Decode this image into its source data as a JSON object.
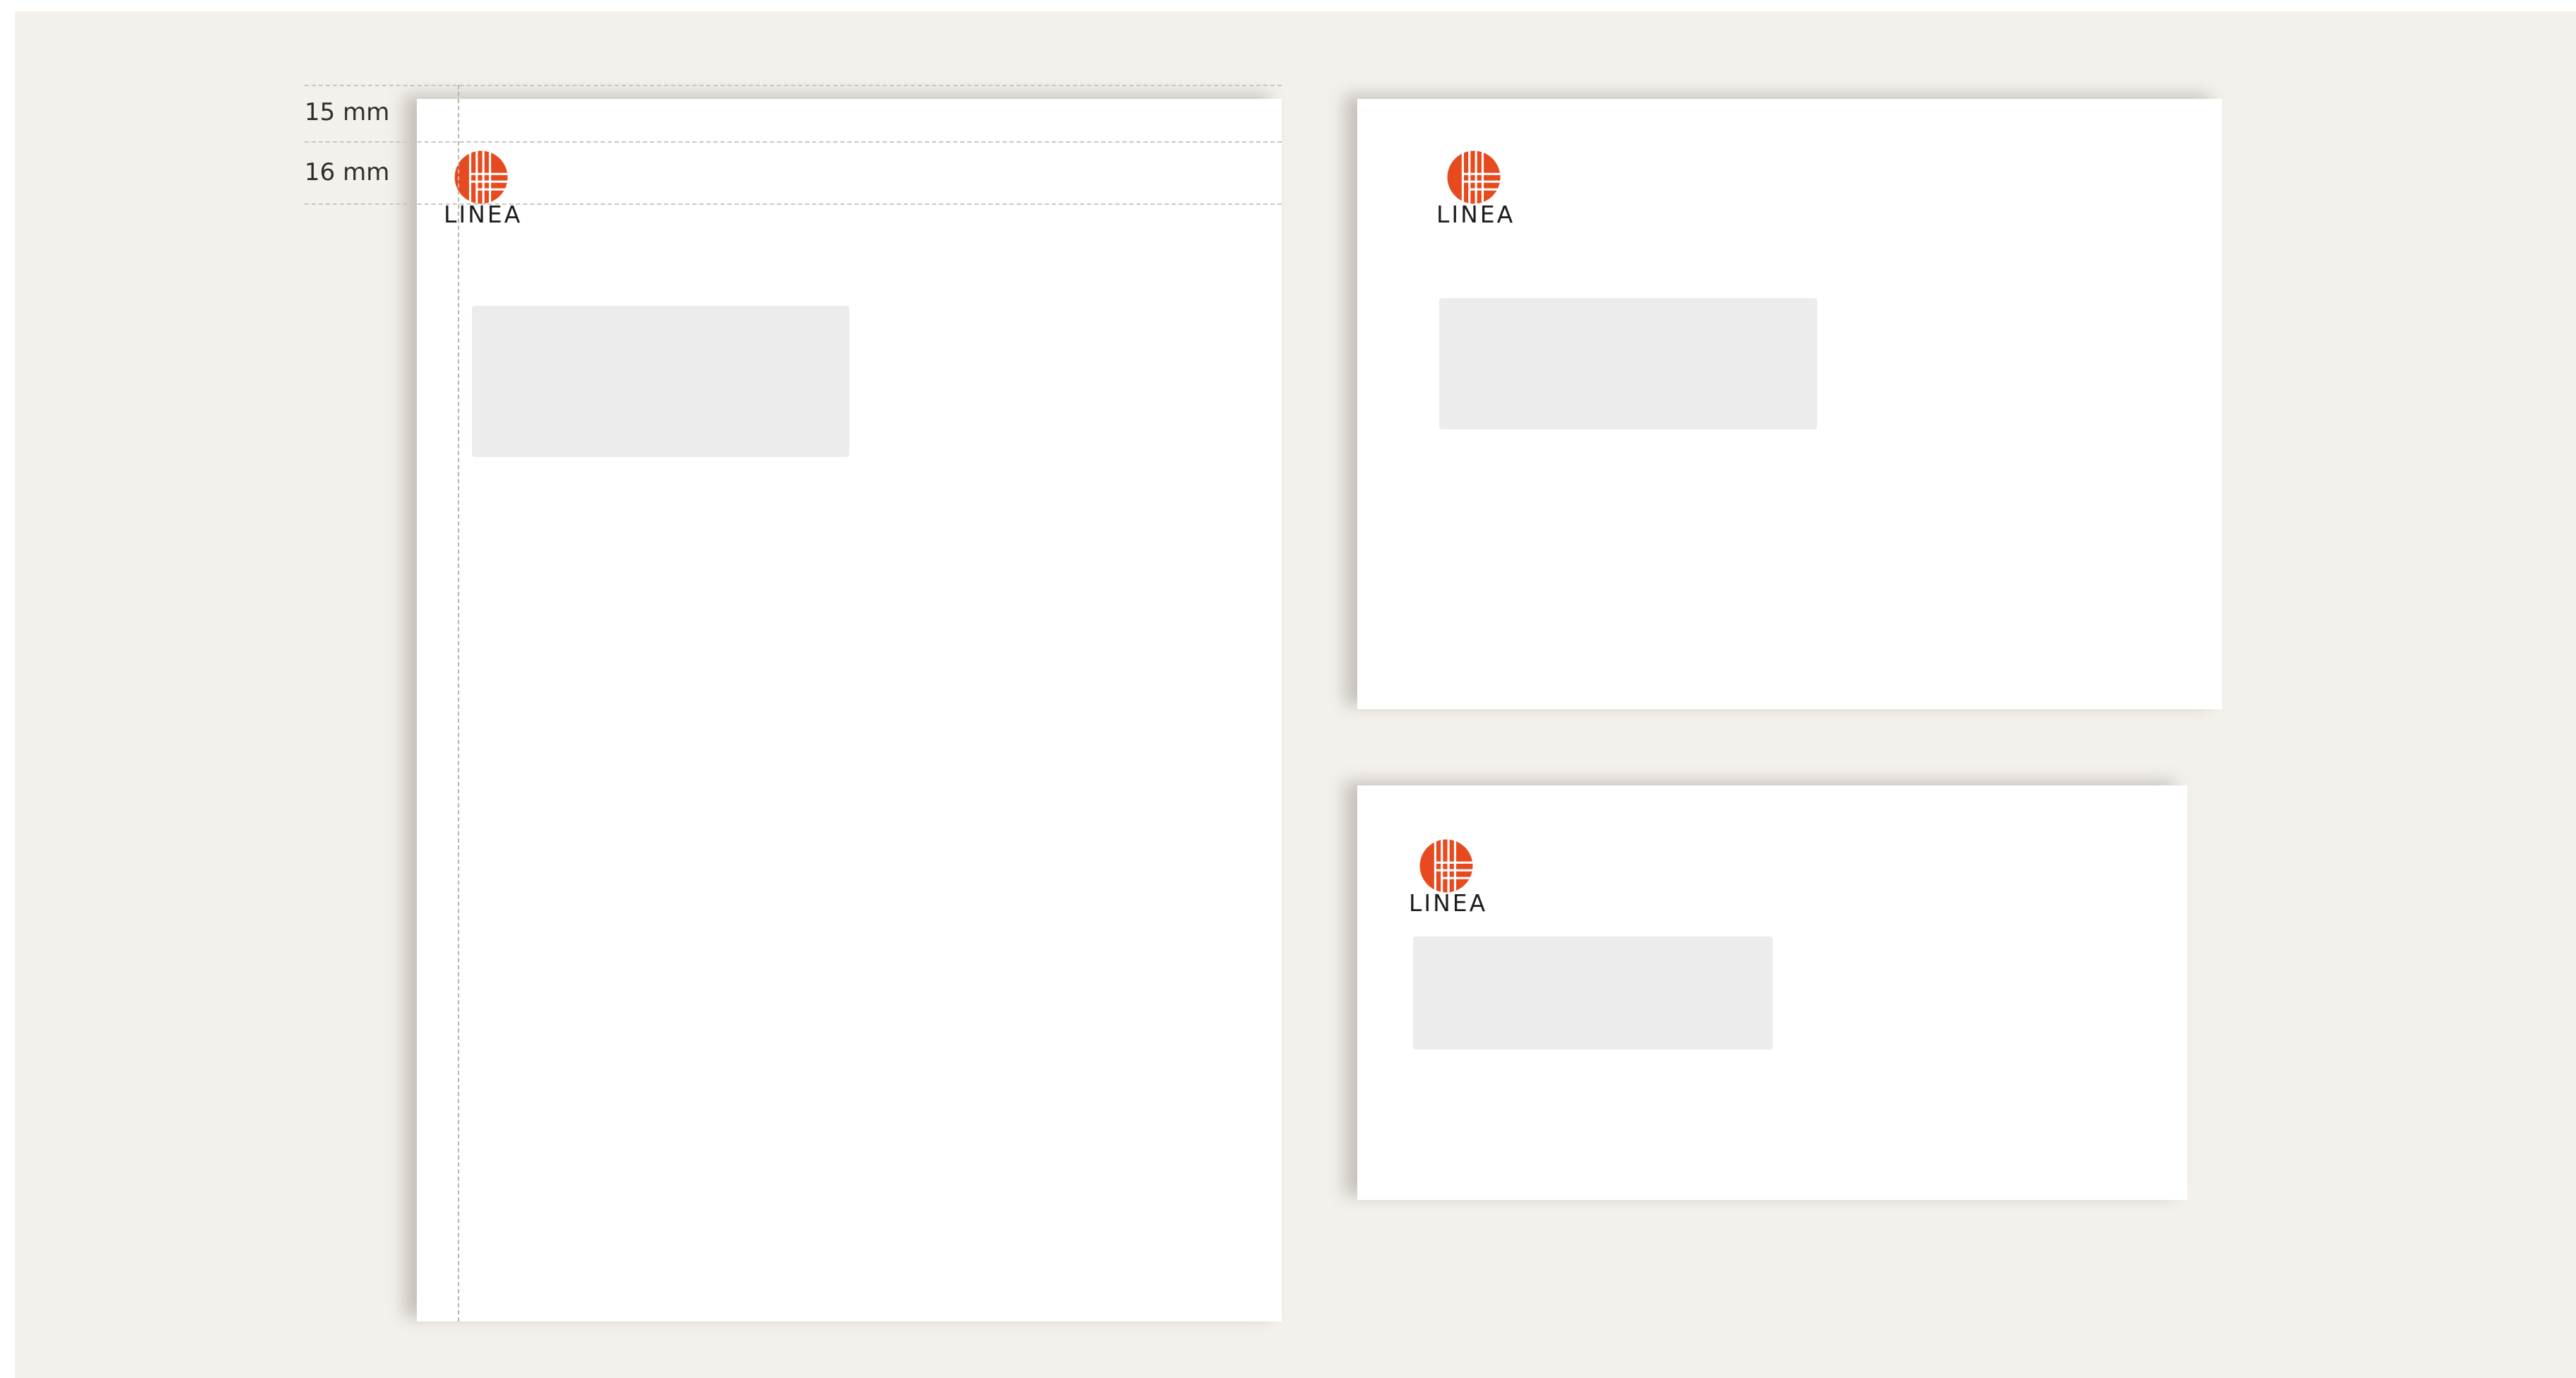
{
  "brand": {
    "name": "LINEA",
    "accent_color": "#e84a1f",
    "wordmark_color": "#1d1d1d"
  },
  "background_color": "#f4f1ec",
  "window_color": "#ececec",
  "dimensions": {
    "top_margin_label": "15 mm",
    "logo_height_label": "16 mm"
  },
  "sheets": [
    {
      "id": "letter",
      "logo_text": "LINEA",
      "logo_icon": "linea-globe-icon"
    },
    {
      "id": "envelope-c5",
      "logo_text": "LINEA",
      "logo_icon": "linea-globe-icon"
    },
    {
      "id": "envelope-dl",
      "logo_text": "LINEA",
      "logo_icon": "linea-globe-icon"
    }
  ]
}
